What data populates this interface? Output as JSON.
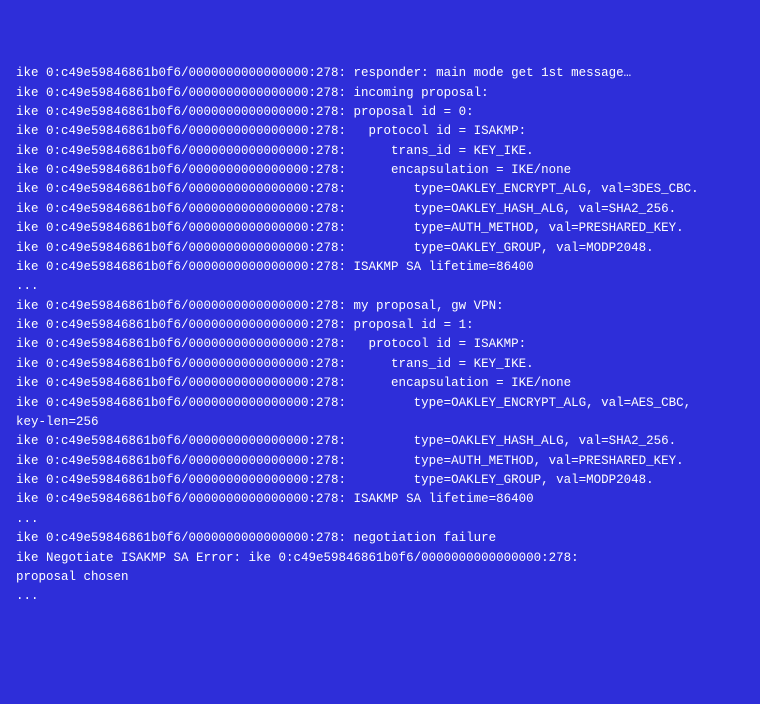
{
  "log": {
    "lines": [
      "ike 0:c49e59846861b0f6/0000000000000000:278: responder: main mode get 1st message…",
      "ike 0:c49e59846861b0f6/0000000000000000:278: incoming proposal:",
      "ike 0:c49e59846861b0f6/0000000000000000:278: proposal id = 0:",
      "ike 0:c49e59846861b0f6/0000000000000000:278:   protocol id = ISAKMP:",
      "ike 0:c49e59846861b0f6/0000000000000000:278:      trans_id = KEY_IKE.",
      "ike 0:c49e59846861b0f6/0000000000000000:278:      encapsulation = IKE/none",
      "ike 0:c49e59846861b0f6/0000000000000000:278:         type=OAKLEY_ENCRYPT_ALG, val=3DES_CBC.",
      "ike 0:c49e59846861b0f6/0000000000000000:278:         type=OAKLEY_HASH_ALG, val=SHA2_256.",
      "ike 0:c49e59846861b0f6/0000000000000000:278:         type=AUTH_METHOD, val=PRESHARED_KEY.",
      "ike 0:c49e59846861b0f6/0000000000000000:278:         type=OAKLEY_GROUP, val=MODP2048.",
      "ike 0:c49e59846861b0f6/0000000000000000:278: ISAKMP SA lifetime=86400",
      "...",
      "ike 0:c49e59846861b0f6/0000000000000000:278: my proposal, gw VPN:",
      "ike 0:c49e59846861b0f6/0000000000000000:278: proposal id = 1:",
      "ike 0:c49e59846861b0f6/0000000000000000:278:   protocol id = ISAKMP:",
      "ike 0:c49e59846861b0f6/0000000000000000:278:      trans_id = KEY_IKE.",
      "ike 0:c49e59846861b0f6/0000000000000000:278:      encapsulation = IKE/none",
      "ike 0:c49e59846861b0f6/0000000000000000:278:         type=OAKLEY_ENCRYPT_ALG, val=AES_CBC,",
      "key-len=256",
      "ike 0:c49e59846861b0f6/0000000000000000:278:         type=OAKLEY_HASH_ALG, val=SHA2_256.",
      "ike 0:c49e59846861b0f6/0000000000000000:278:         type=AUTH_METHOD, val=PRESHARED_KEY.",
      "ike 0:c49e59846861b0f6/0000000000000000:278:         type=OAKLEY_GROUP, val=MODP2048.",
      "ike 0:c49e59846861b0f6/0000000000000000:278: ISAKMP SA lifetime=86400",
      "...",
      "ike 0:c49e59846861b0f6/0000000000000000:278: negotiation failure",
      "ike Negotiate ISAKMP SA Error: ike 0:c49e59846861b0f6/0000000000000000:278:",
      "proposal chosen",
      "..."
    ]
  }
}
